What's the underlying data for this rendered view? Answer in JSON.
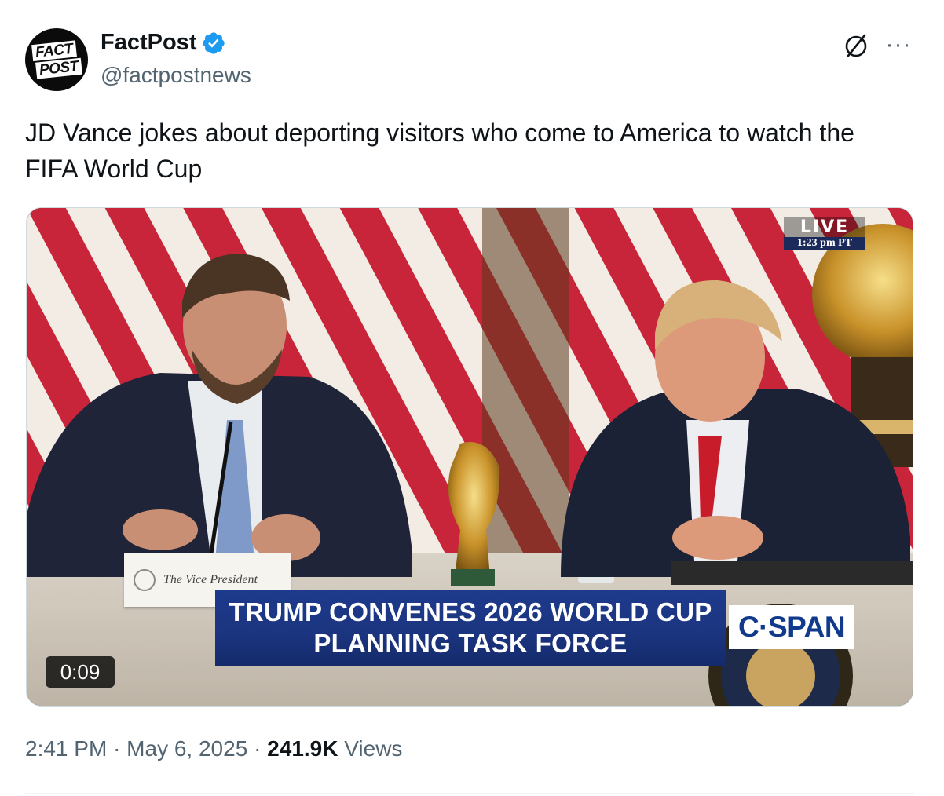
{
  "author": {
    "display_name": "FactPost",
    "handle": "@factpostnews",
    "avatar_logo": {
      "line1": "FACT",
      "line2": "POST"
    },
    "verified_color": "#1d9bf0"
  },
  "header_actions": {
    "grok_icon": "grok-icon",
    "more_label": "···"
  },
  "tweet": {
    "text": "JD Vance jokes about deporting visitors who come to America to watch the FIFA World Cup"
  },
  "video": {
    "duration": "0:09",
    "live_label": "LIVE",
    "live_time": "1:23 pm PT",
    "placard_text": "The Vice President",
    "lower_third_line1": "TRUMP CONVENES 2026 WORLD CUP",
    "lower_third_line2": "PLANNING TASK FORCE",
    "network_logo": "C·SPAN",
    "banner_color": "#1e3a8c"
  },
  "meta": {
    "time": "2:41 PM",
    "separator": "·",
    "date": "May 6, 2025",
    "views_count": "241.9K",
    "views_label": "Views"
  }
}
